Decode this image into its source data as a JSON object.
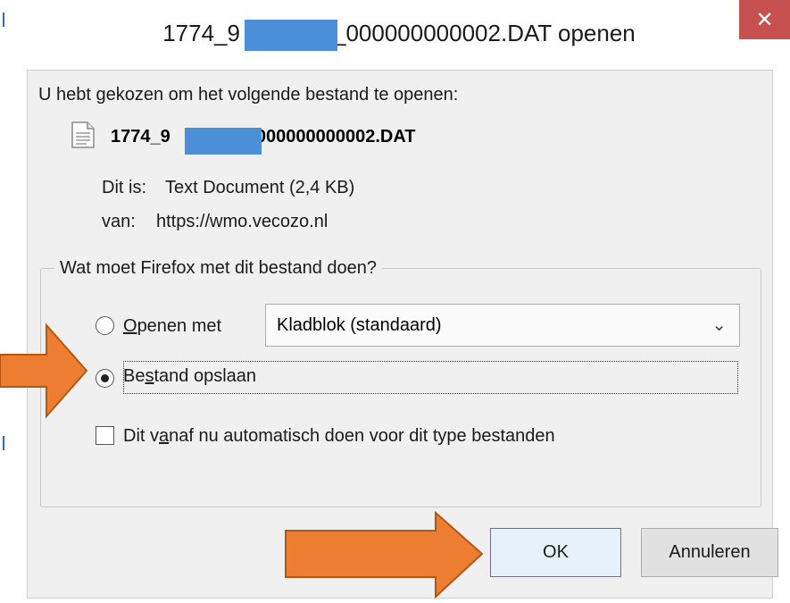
{
  "dialog": {
    "title_prefix": "1774_9",
    "title_suffix": "_000000000002.DAT openen",
    "close_glyph": "✕",
    "prompt": "U hebt gekozen om het volgende bestand te openen:",
    "file": {
      "name_prefix": "1774_9",
      "name_suffix": "_000000000002.DAT",
      "icon": "text-file-icon"
    },
    "type_label": "Dit is:",
    "type_value": "Text Document (2,4 KB)",
    "source_label": "van:",
    "source_value": "https://wmo.vecozo.nl",
    "group_label": "Wat moet Firefox met dit bestand doen?",
    "open_with": {
      "mnemonic": "O",
      "label_rest": "penen met",
      "selected": false,
      "app": "Kladblok (standaard)"
    },
    "save_file": {
      "label_a": "Be",
      "mnemonic": "s",
      "label_b": "tand opslaan",
      "selected": true
    },
    "auto": {
      "label_a": "Dit v",
      "mnemonic": "a",
      "label_b": "naf nu automatisch doen voor dit type bestanden",
      "checked": false
    },
    "ok_label": "OK",
    "cancel_label": "Annuleren"
  },
  "colors": {
    "annotation_arrow": "#ed7d31",
    "redaction": "#4a8fd8",
    "close_button": "#c75050"
  }
}
